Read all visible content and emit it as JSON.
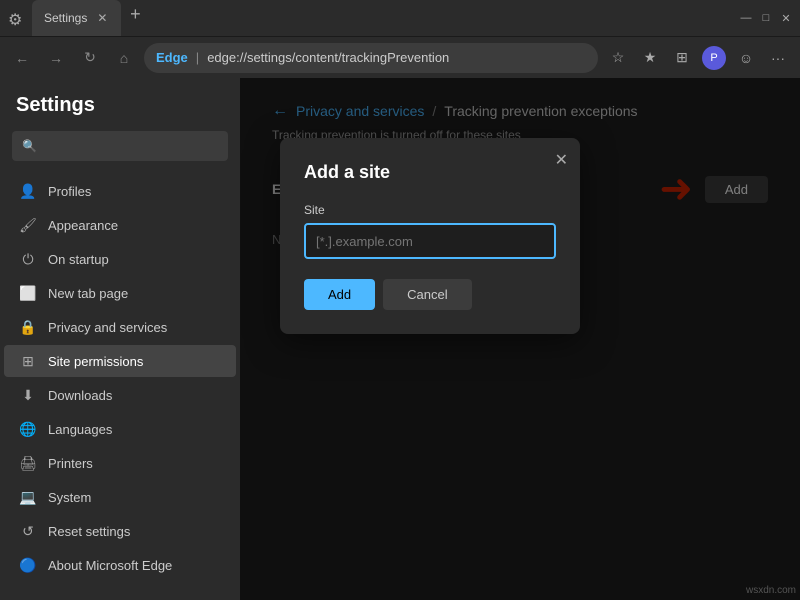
{
  "titlebar": {
    "tab_title": "Settings",
    "tab_icon": "⚙",
    "new_tab_icon": "+",
    "controls": {
      "minimize": "—",
      "maximize": "□",
      "close": "✕"
    }
  },
  "addressbar": {
    "back_icon": "←",
    "forward_icon": "→",
    "refresh_icon": "↻",
    "home_icon": "⌂",
    "edge_label": "Edge",
    "address": "edge://settings/content/trackingPrevention",
    "star_icon": "☆",
    "fav_icon": "★",
    "collection_icon": "⊞",
    "profile_initial": "P",
    "emoji_icon": "☺",
    "menu_icon": "···"
  },
  "sidebar": {
    "title": "Settings",
    "search_placeholder": "",
    "items": [
      {
        "id": "profiles",
        "icon": "👤",
        "label": "Profiles"
      },
      {
        "id": "appearance",
        "icon": "🖌",
        "label": "Appearance"
      },
      {
        "id": "on-startup",
        "icon": "⏻",
        "label": "On startup"
      },
      {
        "id": "new-tab",
        "icon": "⬜",
        "label": "New tab page"
      },
      {
        "id": "privacy",
        "icon": "🔒",
        "label": "Privacy and services"
      },
      {
        "id": "site-permissions",
        "icon": "⊞",
        "label": "Site permissions",
        "active": true
      },
      {
        "id": "downloads",
        "icon": "⬇",
        "label": "Downloads"
      },
      {
        "id": "languages",
        "icon": "🌐",
        "label": "Languages"
      },
      {
        "id": "printers",
        "icon": "🖨",
        "label": "Printers"
      },
      {
        "id": "system",
        "icon": "💻",
        "label": "System"
      },
      {
        "id": "reset",
        "icon": "↺",
        "label": "Reset settings"
      },
      {
        "id": "about",
        "icon": "🔵",
        "label": "About Microsoft Edge"
      }
    ]
  },
  "content": {
    "breadcrumb_back_icon": "←",
    "breadcrumb_link": "Privacy and services",
    "breadcrumb_separator": "/",
    "page_title": "Tracking prevention exceptions",
    "page_subtitle": "Tracking prevention is turned off for these sites",
    "exceptions_label": "Exceptions",
    "add_button_label": "Add",
    "no_sites_text": "No sites added"
  },
  "modal": {
    "title": "Add a site",
    "close_icon": "✕",
    "site_label": "Site",
    "input_placeholder": "[*.].example.com",
    "add_button": "Add",
    "cancel_button": "Cancel"
  },
  "watermark": "wsxdn.com"
}
